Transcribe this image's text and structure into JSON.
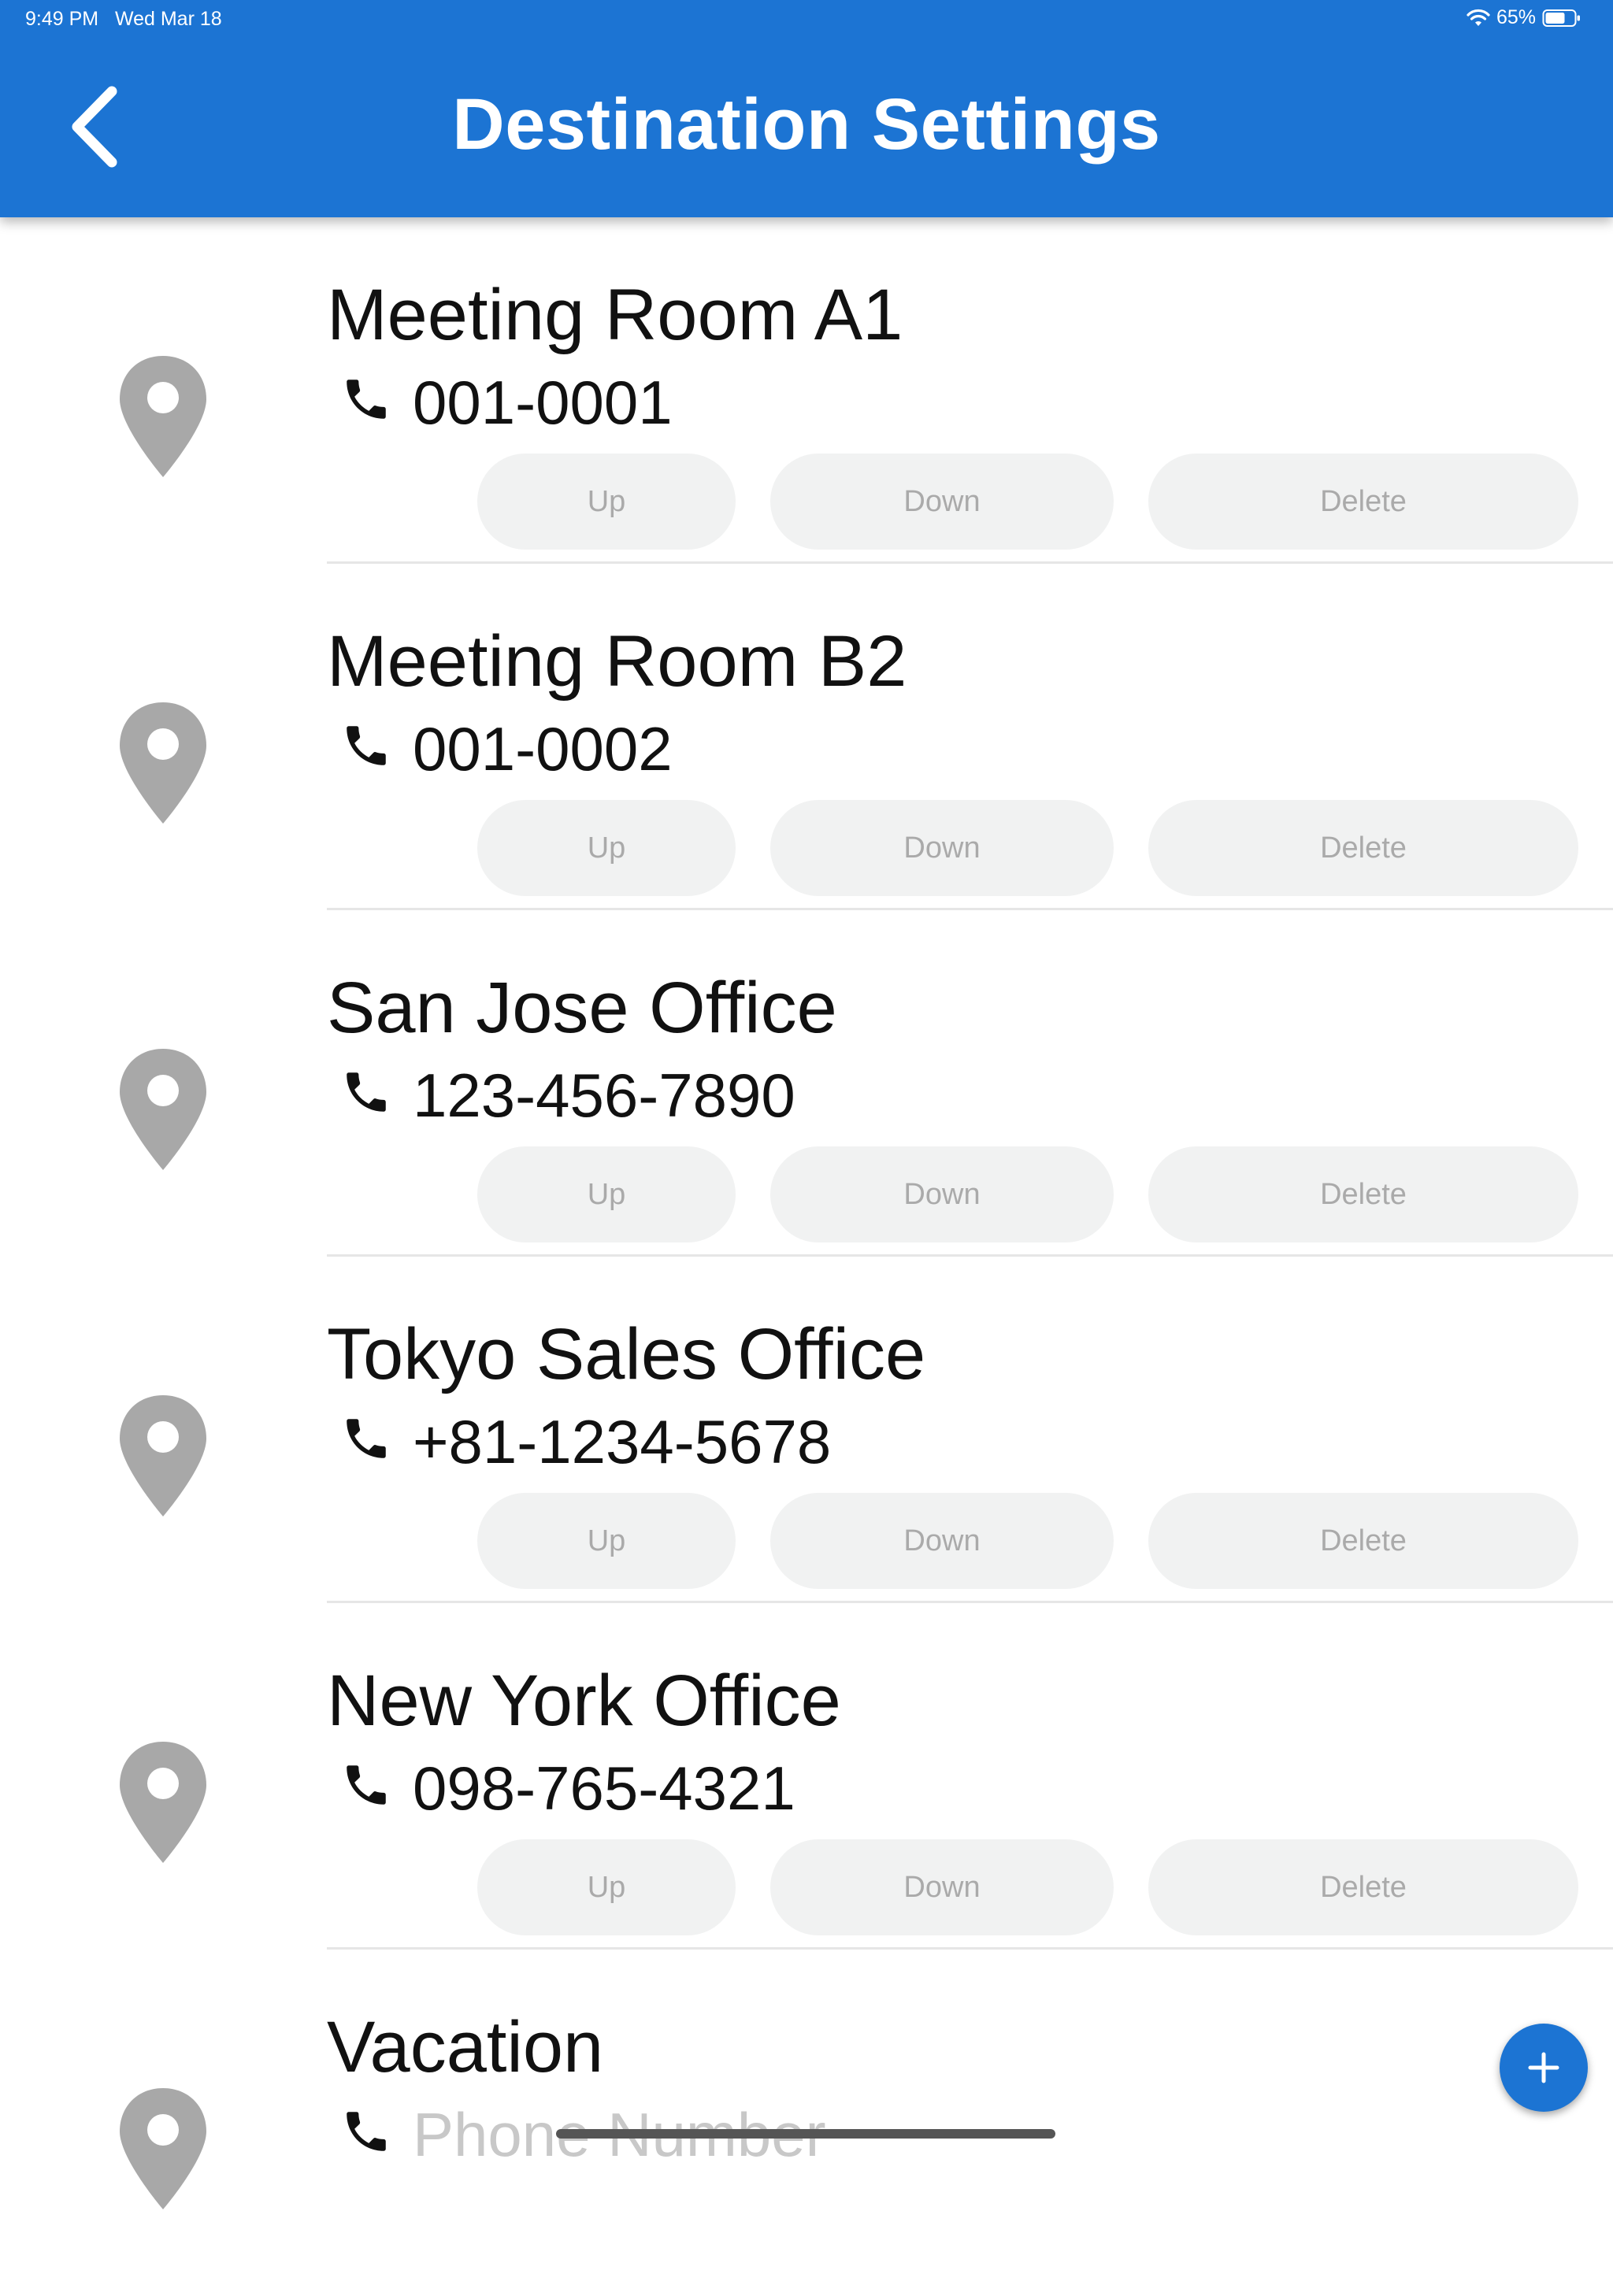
{
  "status_bar": {
    "time": "9:49 PM",
    "date": "Wed Mar 18",
    "battery": "65%"
  },
  "header": {
    "title": "Destination Settings",
    "back_icon": "chevron-left-icon"
  },
  "destinations": [
    {
      "name": "Meeting Room A1",
      "phone": "001-0001",
      "up": "Up",
      "down": "Down",
      "delete": "Delete"
    },
    {
      "name": "Meeting Room B2",
      "phone": "001-0002",
      "up": "Up",
      "down": "Down",
      "delete": "Delete"
    },
    {
      "name": "San Jose Office",
      "phone": "123-456-7890",
      "up": "Up",
      "down": "Down",
      "delete": "Delete"
    },
    {
      "name": "Tokyo Sales Office",
      "phone": "+81-1234-5678",
      "up": "Up",
      "down": "Down",
      "delete": "Delete"
    },
    {
      "name": "New York Office",
      "phone": "098-765-4321",
      "up": "Up",
      "down": "Down",
      "delete": "Delete"
    },
    {
      "name": "Vacation",
      "phone_placeholder": "Phone Number"
    }
  ],
  "colors": {
    "primary": "#1c74d3",
    "pin": "#a8a8a8",
    "button_bg": "#f1f2f2",
    "button_text": "#aaaaaa"
  },
  "fab": {
    "icon": "plus-icon"
  }
}
